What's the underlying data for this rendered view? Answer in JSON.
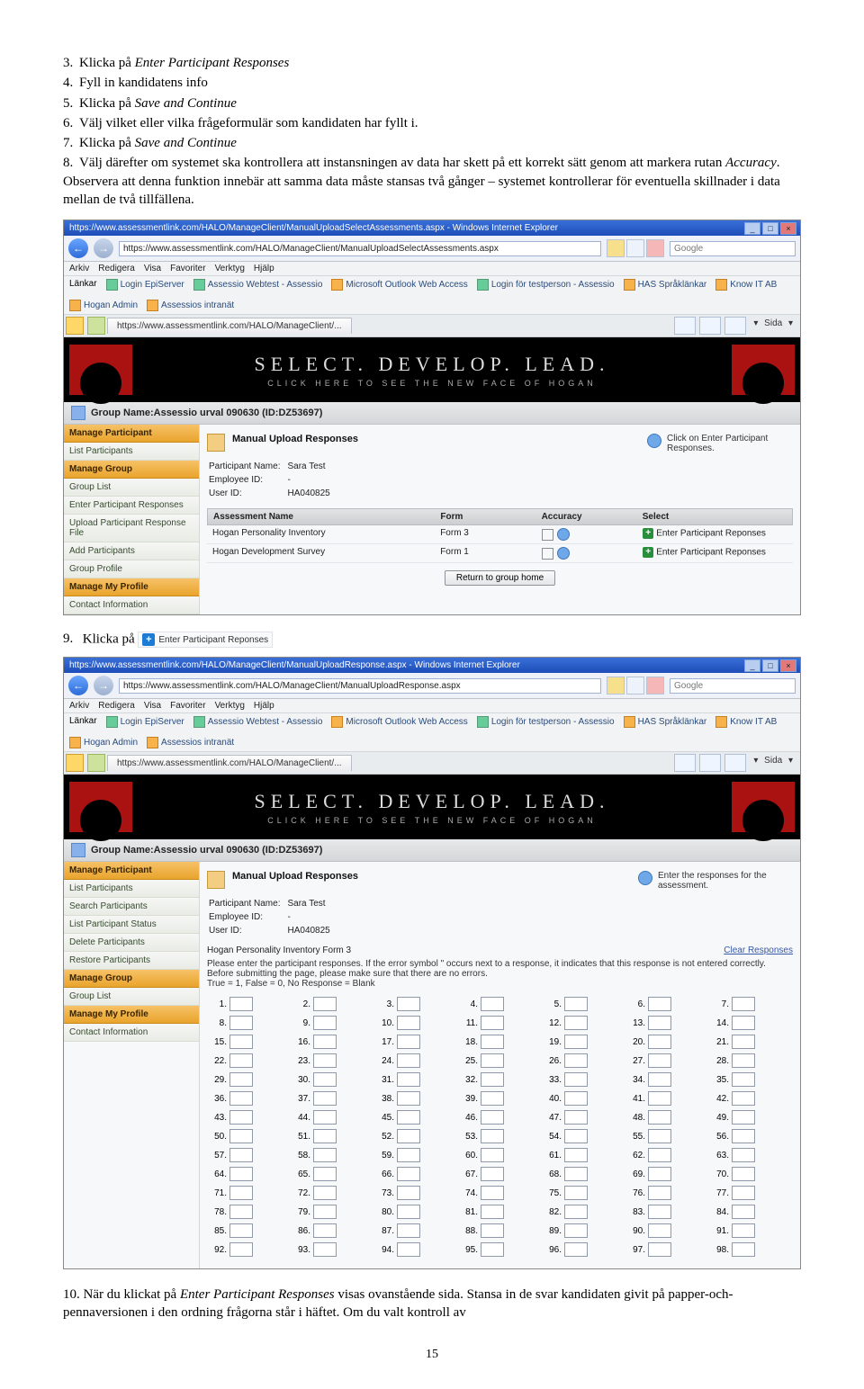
{
  "steps": {
    "s3": {
      "num": "3.",
      "text_a": "Klicka på ",
      "em": "Enter Participant Responses"
    },
    "s4": {
      "num": "4.",
      "text": "Fyll in kandidatens info"
    },
    "s5": {
      "num": "5.",
      "text_a": "Klicka på ",
      "em": "Save and Continue"
    },
    "s6": {
      "num": "6.",
      "text": "Välj vilket eller vilka frågeformulär som kandidaten har fyllt i."
    },
    "s7": {
      "num": "7.",
      "text_a": "Klicka på ",
      "em": "Save and Continue"
    },
    "s8": {
      "num": "8.",
      "text_a": "Välj därefter om systemet ska kontrollera att instansningen av data har skett på ett korrekt sätt genom att markera rutan ",
      "em": "Accuracy",
      "text_b": ". Observera att denna funktion innebär att samma data måste stansas två gånger – systemet kontrollerar för eventuella skillnader i data mellan de två tillfällena."
    },
    "s9": {
      "num": "9.",
      "text": "Klicka på",
      "epr": "Enter Participant Reponses"
    },
    "s10": {
      "num": "10.",
      "text_a": "När du klickat på ",
      "em": "Enter Participant Responses",
      "text_b": " visas ovanstående sida. Stansa in de svar kandidaten givit på papper-och-pennaversionen i den ordning frågorna står i häftet. Om du valt kontroll av"
    }
  },
  "pagenum": "15",
  "shot1": {
    "title": "https://www.assessmentlink.com/HALO/ManageClient/ManualUploadSelectAssessments.aspx - Windows Internet Explorer",
    "url": "https://www.assessmentlink.com/HALO/ManageClient/ManualUploadSelectAssessments.aspx",
    "search": "Google",
    "menu": [
      "Arkiv",
      "Redigera",
      "Visa",
      "Favoriter",
      "Verktyg",
      "Hjälp"
    ],
    "links_label": "Länkar",
    "links": [
      "Login EpiServer",
      "Assessio Webtest - Assessio",
      "Microsoft Outlook Web Access",
      "Login för testperson - Assessio",
      "HAS Språklänkar",
      "Know IT AB",
      "Hogan Admin",
      "Assessios intranät"
    ],
    "tab": "https://www.assessmentlink.com/HALO/ManageClient/...",
    "tbar_sida": "Sida",
    "banner_big": "SELECT. DEVELOP. LEAD.",
    "banner_sm": "CLICK HERE TO SEE THE NEW FACE OF HOGAN",
    "group": "Group Name:Assessio urval 090630 (ID:DZ53697)",
    "sidebar": {
      "h1": "Manage Participant",
      "i1": "List Participants",
      "h2": "Manage Group",
      "i2": "Group List",
      "i3": "Enter Participant Responses",
      "i4": "Upload Participant Response File",
      "i5": "Add Participants",
      "i6": "Group Profile",
      "h3": "Manage My Profile",
      "i7": "Contact Information"
    },
    "panel": {
      "title": "Manual Upload Responses",
      "hint": "Click on Enter Participant Responses.",
      "meta": {
        "pn_l": "Participant Name:",
        "pn_v": "Sara Test",
        "eid_l": "Employee ID:",
        "eid_v": "-",
        "uid_l": "User ID:",
        "uid_v": "HA040825"
      },
      "th": {
        "c1": "Assessment Name",
        "c2": "Form",
        "c3": "Accuracy",
        "c4": "Select"
      },
      "rows": [
        {
          "name": "Hogan Personality Inventory",
          "form": "Form 3",
          "link": "Enter Participant Reponses"
        },
        {
          "name": "Hogan Development Survey",
          "form": "Form 1",
          "link": "Enter Participant Reponses"
        }
      ],
      "btn": "Return to group home"
    }
  },
  "shot2": {
    "title": "https://www.assessmentlink.com/HALO/ManageClient/ManualUploadResponse.aspx - Windows Internet Explorer",
    "url": "https://www.assessmentlink.com/HALO/ManageClient/ManualUploadResponse.aspx",
    "search": "Google",
    "menu": [
      "Arkiv",
      "Redigera",
      "Visa",
      "Favoriter",
      "Verktyg",
      "Hjälp"
    ],
    "links_label": "Länkar",
    "links": [
      "Login EpiServer",
      "Assessio Webtest - Assessio",
      "Microsoft Outlook Web Access",
      "Login för testperson - Assessio",
      "HAS Språklänkar",
      "Know IT AB",
      "Hogan Admin",
      "Assessios intranät"
    ],
    "tab": "https://www.assessmentlink.com/HALO/ManageClient/...",
    "tbar_sida": "Sida",
    "banner_big": "SELECT. DEVELOP. LEAD.",
    "banner_sm": "CLICK HERE TO SEE THE NEW FACE OF HOGAN",
    "group": "Group Name:Assessio urval 090630 (ID:DZ53697)",
    "sidebar": {
      "h1": "Manage Participant",
      "i1": "List Participants",
      "i2": "Search Participants",
      "i3": "List Participant Status",
      "i4": "Delete Participants",
      "i5": "Restore Participants",
      "h2": "Manage Group",
      "i6": "Group List",
      "h3": "Manage My Profile",
      "i7": "Contact Information"
    },
    "panel": {
      "title": "Manual Upload Responses",
      "hint": "Enter the responses for the assessment.",
      "meta": {
        "pn_l": "Participant Name:",
        "pn_v": "Sara Test",
        "eid_l": "Employee ID:",
        "eid_v": "-",
        "uid_l": "User ID:",
        "uid_v": "HA040825"
      },
      "subhead": "Hogan Personality Inventory Form 3",
      "clear": "Clear Responses",
      "intro": "Please enter the participant responses. If the error symbol \" occurs next to a response, it indicates that this response is not entered correctly. Before submitting the page, please make sure that there are no errors.\nTrue = 1, False = 0, No Response = Blank"
    }
  }
}
